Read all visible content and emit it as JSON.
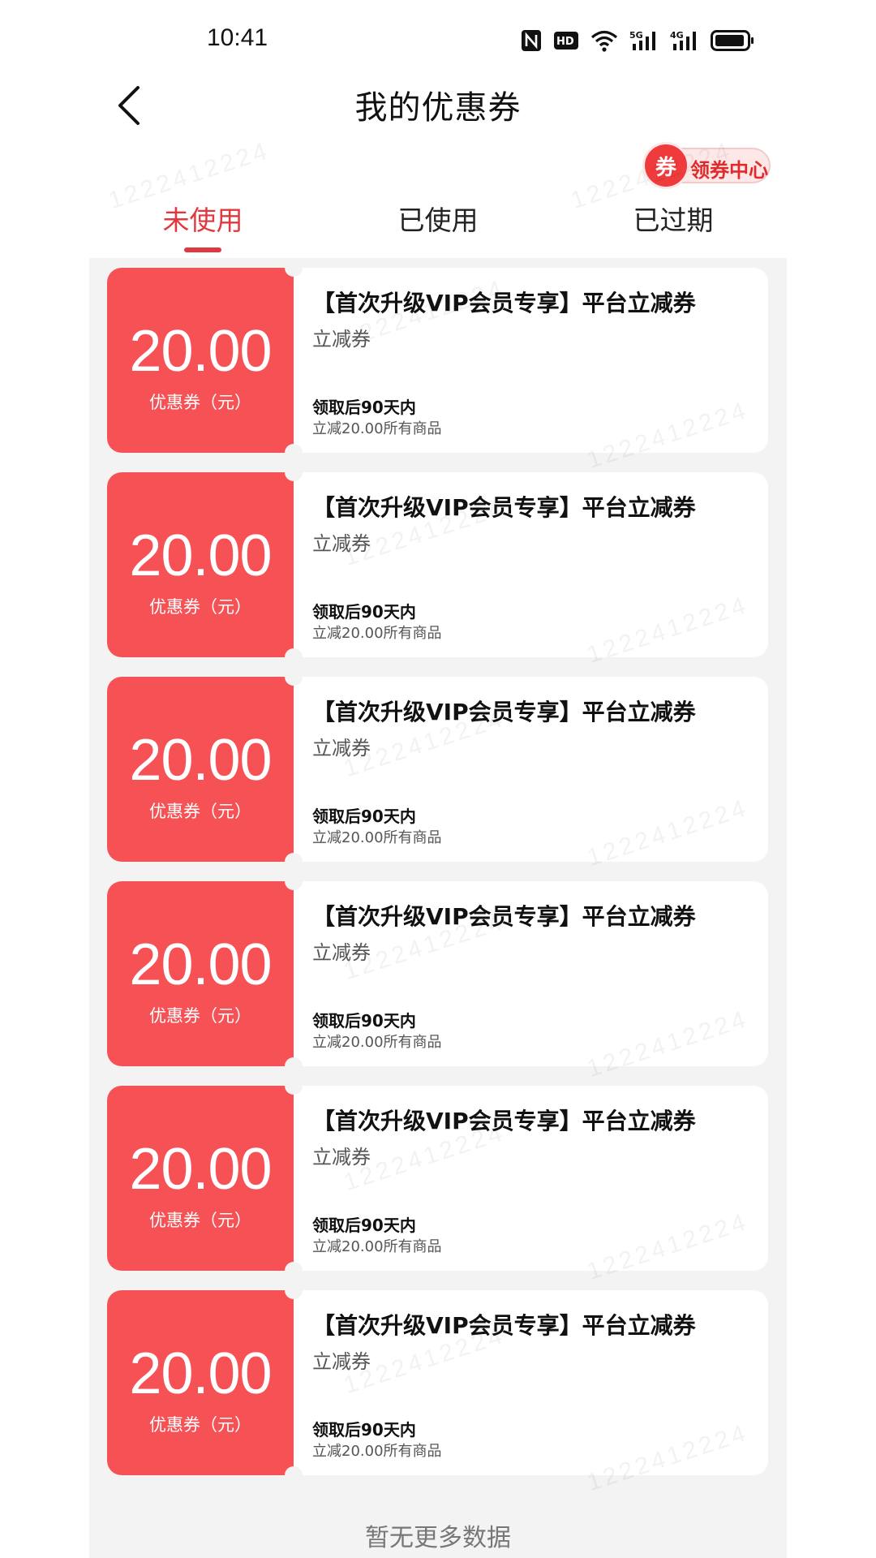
{
  "status_bar": {
    "time": "10:41",
    "icons": [
      "nfc-icon",
      "hd-icon",
      "wifi-icon",
      "signal-5g-icon",
      "signal-4g-icon",
      "battery-icon"
    ]
  },
  "header": {
    "title": "我的优惠券"
  },
  "coupon_center": {
    "badge": "券",
    "label": "领券中心"
  },
  "tabs": [
    {
      "label": "未使用",
      "active": true
    },
    {
      "label": "已使用",
      "active": false
    },
    {
      "label": "已过期",
      "active": false
    }
  ],
  "coupons": [
    {
      "amount": "20.00",
      "unit": "优惠券（元）",
      "title": "【首次升级VIP会员专享】平台立减券",
      "type": "立减券",
      "validity": "领取后90天内",
      "desc": "立减20.00所有商品"
    },
    {
      "amount": "20.00",
      "unit": "优惠券（元）",
      "title": "【首次升级VIP会员专享】平台立减券",
      "type": "立减券",
      "validity": "领取后90天内",
      "desc": "立减20.00所有商品"
    },
    {
      "amount": "20.00",
      "unit": "优惠券（元）",
      "title": "【首次升级VIP会员专享】平台立减券",
      "type": "立减券",
      "validity": "领取后90天内",
      "desc": "立减20.00所有商品"
    },
    {
      "amount": "20.00",
      "unit": "优惠券（元）",
      "title": "【首次升级VIP会员专享】平台立减券",
      "type": "立减券",
      "validity": "领取后90天内",
      "desc": "立减20.00所有商品"
    },
    {
      "amount": "20.00",
      "unit": "优惠券（元）",
      "title": "【首次升级VIP会员专享】平台立减券",
      "type": "立减券",
      "validity": "领取后90天内",
      "desc": "立减20.00所有商品"
    },
    {
      "amount": "20.00",
      "unit": "优惠券（元）",
      "title": "【首次升级VIP会员专享】平台立减券",
      "type": "立减券",
      "validity": "领取后90天内",
      "desc": "立减20.00所有商品"
    }
  ],
  "footer": {
    "no_more": "暂无更多数据"
  },
  "watermark": "1222412224",
  "colors": {
    "accent": "#e0383e",
    "coupon_red": "#f65256",
    "list_bg": "#f3f3f3"
  }
}
